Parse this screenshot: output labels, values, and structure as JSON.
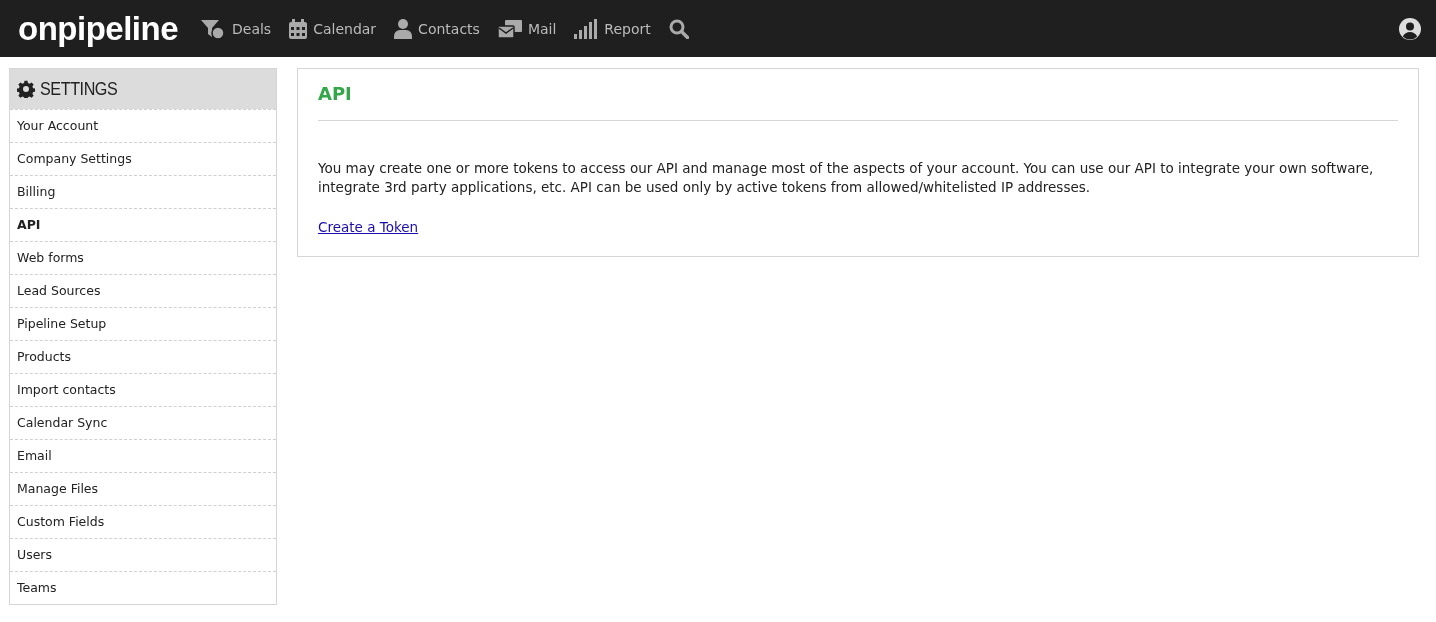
{
  "brand": {
    "logo": "onpipeline"
  },
  "nav": [
    {
      "kind": "deals",
      "label": "Deals"
    },
    {
      "kind": "calendar",
      "label": "Calendar"
    },
    {
      "kind": "contacts",
      "label": "Contacts"
    },
    {
      "kind": "mail",
      "label": "Mail"
    },
    {
      "kind": "report",
      "label": "Report"
    },
    {
      "kind": "search"
    }
  ],
  "sidebar": {
    "title": "SETTINGS",
    "items": [
      {
        "label": "Your Account",
        "selected": false
      },
      {
        "label": "Company Settings",
        "selected": false
      },
      {
        "label": "Billing",
        "selected": false
      },
      {
        "label": "API",
        "selected": true
      },
      {
        "label": "Web forms",
        "selected": false
      },
      {
        "label": "Lead Sources",
        "selected": false
      },
      {
        "label": "Pipeline Setup",
        "selected": false
      },
      {
        "label": "Products",
        "selected": false
      },
      {
        "label": "Import contacts",
        "selected": false
      },
      {
        "label": "Calendar Sync",
        "selected": false
      },
      {
        "label": "Email",
        "selected": false
      },
      {
        "label": "Manage Files",
        "selected": false
      },
      {
        "label": "Custom Fields",
        "selected": false
      },
      {
        "label": "Users",
        "selected": false
      },
      {
        "label": "Teams",
        "selected": false
      }
    ]
  },
  "panel": {
    "title": "API",
    "description": "You may create one or more tokens to access our API and manage most of the aspects of your account. You can use our API to integrate your own software, integrate 3rd party applications, etc. API can be used only by active tokens from allowed/whitelisted IP addresses.",
    "link": "Create a Token"
  }
}
